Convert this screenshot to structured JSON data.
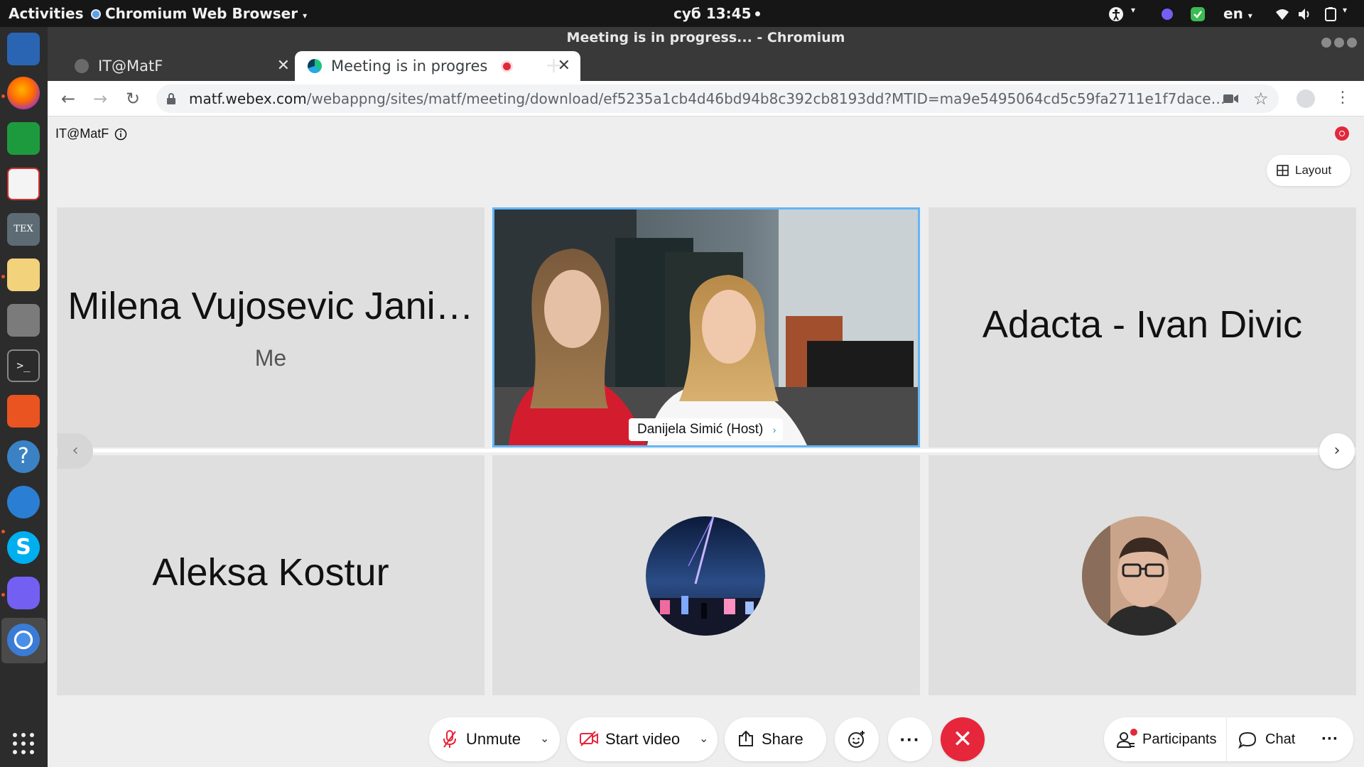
{
  "topbar": {
    "activities": "Activities",
    "app_menu": "Chromium Web Browser",
    "clock": "суб 13:45",
    "language": "en"
  },
  "browser": {
    "window_title": "Meeting is in progress... - Chromium",
    "tabs": [
      {
        "label": "IT@MatF",
        "active": false
      },
      {
        "label": "Meeting is in progres",
        "active": true
      }
    ],
    "url_host": "matf.webex.com",
    "url_path": "/webappng/sites/matf/meeting/download/ef5235a1cb4d46bd94b8c392cb8193dd?MTID=ma9e5495064cd5c59fa2711e1f7dace90&launchApp..."
  },
  "meeting": {
    "name": "IT@MatF",
    "layout_label": "Layout",
    "tiles": [
      {
        "name": "Milena Vujosevic Jani…",
        "sub": "Me",
        "type": "name"
      },
      {
        "name": "Danijela Simić (Host)",
        "type": "video"
      },
      {
        "name": "Adacta - Ivan Divic",
        "type": "name"
      },
      {
        "name": "Aleksa Kostur",
        "type": "name"
      },
      {
        "type": "avatar",
        "avatar": "night-city-artwork"
      },
      {
        "type": "avatar",
        "avatar": "man-with-glasses-photo"
      }
    ]
  },
  "controls": {
    "unmute": "Unmute",
    "start_video": "Start video",
    "share": "Share",
    "more": "···",
    "participants": "Participants",
    "chat": "Chat",
    "panel_more": "···"
  },
  "colors": {
    "leave": "#e6263b",
    "active_speaker_border": "#64b5f6",
    "recording": "#e2283b",
    "dock_indicator": "#e95420"
  }
}
